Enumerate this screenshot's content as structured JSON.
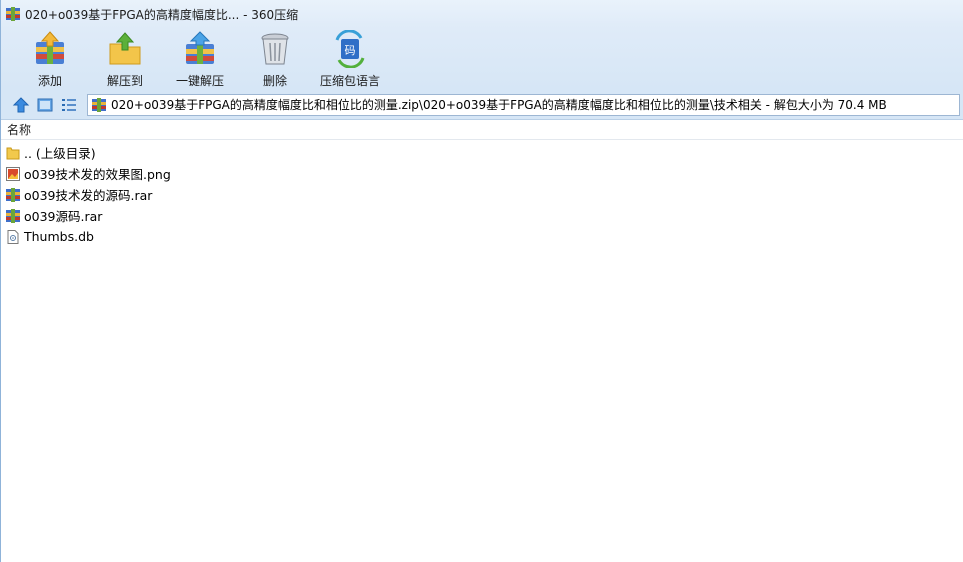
{
  "window": {
    "title": "020+o039基于FPGA的高精度幅度比... - 360压缩"
  },
  "toolbar": {
    "buttons": [
      {
        "label": "添加",
        "icon": "add-archive-icon"
      },
      {
        "label": "解压到",
        "icon": "extract-to-icon"
      },
      {
        "label": "一键解压",
        "icon": "one-click-extract-icon"
      },
      {
        "label": "删除",
        "icon": "delete-trash-icon"
      },
      {
        "label": "压缩包语言",
        "icon": "archive-language-icon"
      }
    ]
  },
  "navbar": {
    "up_icon": "up-arrow-icon",
    "view_icon": "thumbnail-view-icon",
    "list_icon": "list-view-icon",
    "address": "020+o039基于FPGA的高精度幅度比和相位比的测量.zip\\020+o039基于FPGA的高精度幅度比和相位比的测量\\技术相关 - 解包大小为 70.4 MB"
  },
  "list": {
    "header_name": "名称",
    "files": [
      {
        "name": ".. (上级目录)",
        "icon": "folder-icon"
      },
      {
        "name": "o039技术发的效果图.png",
        "icon": "image-file-icon"
      },
      {
        "name": "o039技术发的源码.rar",
        "icon": "rar-file-icon"
      },
      {
        "name": "o039源码.rar",
        "icon": "rar-file-icon"
      },
      {
        "name": "Thumbs.db",
        "icon": "db-file-icon"
      }
    ]
  },
  "colors": {
    "titlebar": "#e9f2fb",
    "toolbar": "#d6e6f6",
    "accent": "#2f7fd1"
  }
}
